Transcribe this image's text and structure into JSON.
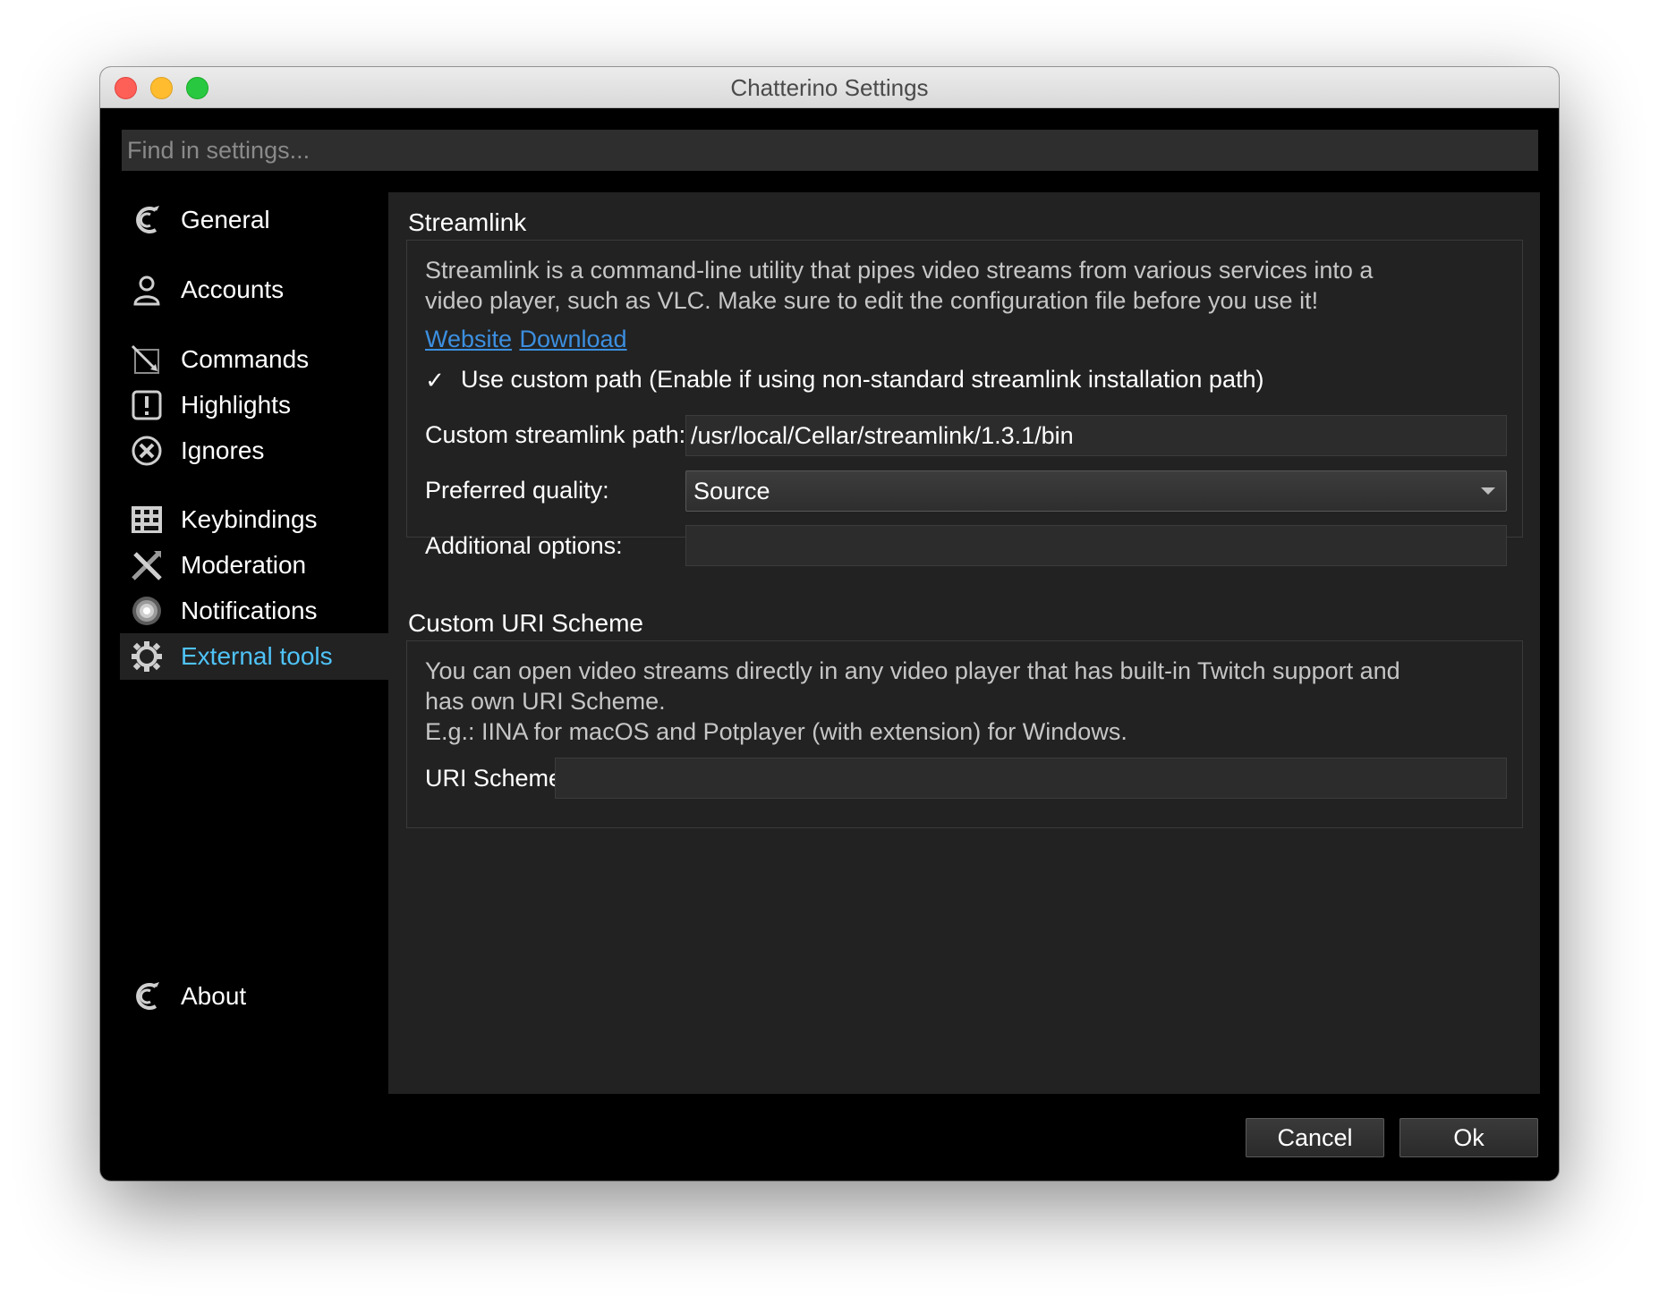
{
  "window": {
    "title": "Chatterino Settings"
  },
  "search": {
    "placeholder": "Find in settings..."
  },
  "sidebar": {
    "items": [
      {
        "label": "General",
        "icon": "chatterino-logo-icon"
      },
      {
        "label": "Accounts",
        "icon": "user-icon"
      },
      {
        "label": "Commands",
        "icon": "commands-icon"
      },
      {
        "label": "Highlights",
        "icon": "exclamation-icon"
      },
      {
        "label": "Ignores",
        "icon": "ignore-x-icon"
      },
      {
        "label": "Keybindings",
        "icon": "keyboard-icon"
      },
      {
        "label": "Moderation",
        "icon": "swords-icon"
      },
      {
        "label": "Notifications",
        "icon": "notification-icon"
      },
      {
        "label": "External tools",
        "icon": "gear-icon",
        "active": true
      }
    ],
    "about": {
      "label": "About",
      "icon": "chatterino-logo-icon"
    }
  },
  "streamlink": {
    "title": "Streamlink",
    "description_line1": "Streamlink is a command-line utility that pipes video streams from various services into a",
    "description_line2": "video player, such as VLC. Make sure to edit the configuration file before you use it!",
    "website_link": "Website",
    "download_link": "Download",
    "custom_path_checkbox_label": "Use custom path (Enable if using non-standard streamlink installation path)",
    "custom_path_checked": true,
    "custom_path_label": "Custom streamlink path:",
    "custom_path_value": "/usr/local/Cellar/streamlink/1.3.1/bin",
    "quality_label": "Preferred quality:",
    "quality_value": "Source",
    "options_label": "Additional options:",
    "options_value": ""
  },
  "uri_scheme": {
    "title": "Custom URI Scheme",
    "description_line1": "You can open video streams directly in any video player that has built-in Twitch support and",
    "description_line2": "has own URI Scheme.",
    "description_line3": "E.g.: IINA for macOS and Potplayer (with extension) for Windows.",
    "label": "URI Scheme:",
    "value": ""
  },
  "buttons": {
    "cancel": "Cancel",
    "ok": "Ok"
  },
  "colors": {
    "accent": "#4fc3f7",
    "link": "#3c8fe0",
    "background": "#000000",
    "panel": "#222222"
  }
}
